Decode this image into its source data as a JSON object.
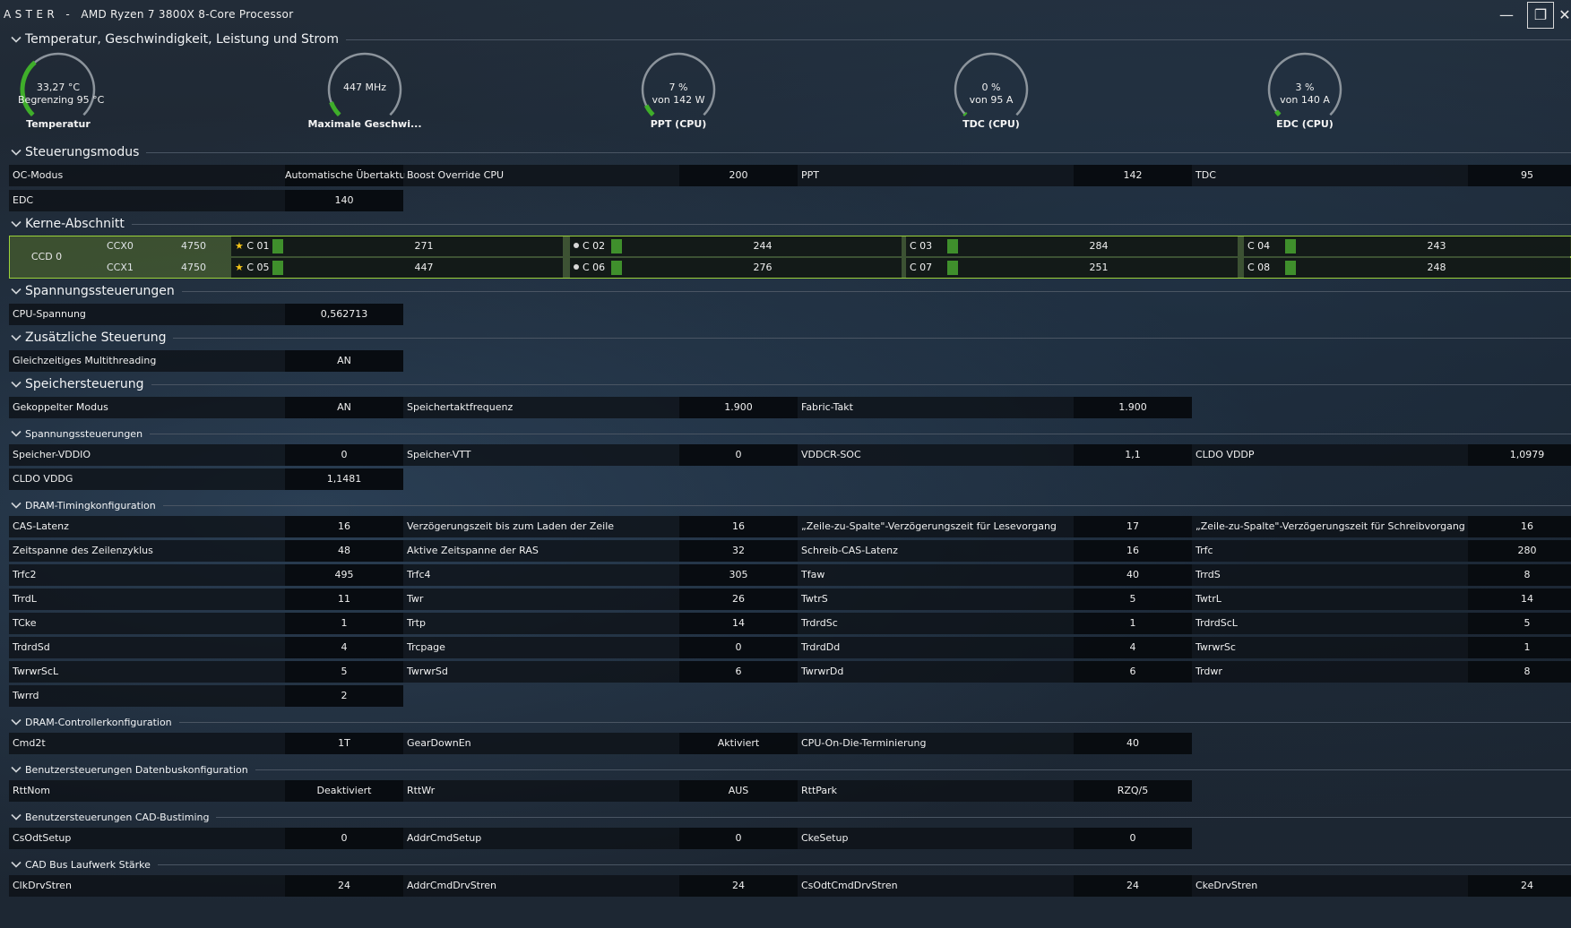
{
  "window": {
    "title": "A S T E R   -   AMD Ryzen 7 3800X 8-Core Processor",
    "min": "—",
    "max": "❐",
    "close": "✕"
  },
  "sections": {
    "temp": "Temperatur, Geschwindigkeit, Leistung und Strom",
    "mode": "Steuerungsmodus",
    "cores": "Kerne-Abschnitt",
    "volt": "Spannungssteuerungen",
    "extra": "Zusätzliche Steuerung",
    "mem": "Speichersteuerung",
    "memvolt": "Spannungssteuerungen",
    "dram": "DRAM-Timingkonfiguration",
    "ctrl": "DRAM-Controllerkonfiguration",
    "bus": "Benutzersteuerungen Datenbuskonfiguration",
    "cad": "Benutzersteuerungen CAD-Bustiming",
    "drv": "CAD Bus Laufwerk Stärke"
  },
  "gauges": [
    {
      "line1": "33,27 °C",
      "line2": "Begrenzing  95 °C",
      "caption": "Temperatur",
      "fill": 0.35
    },
    {
      "line1": "447  MHz",
      "line2": "",
      "caption": "Maximale Geschwi...",
      "fill": 0.09
    },
    {
      "line1": "7 %",
      "line2": "von  142 W",
      "caption": "PPT (CPU)",
      "fill": 0.07
    },
    {
      "line1": "0 %",
      "line2": "von  95 A",
      "caption": "TDC (CPU)",
      "fill": 0.0
    },
    {
      "line1": "3 %",
      "line2": "von  140 A",
      "caption": "EDC (CPU)",
      "fill": 0.03
    }
  ],
  "mode": [
    {
      "k": "OC-Modus",
      "v": "Automatische Übertaktu..."
    },
    {
      "k": "Boost Override CPU",
      "v": "200"
    },
    {
      "k": "PPT",
      "v": "142"
    },
    {
      "k": "TDC",
      "v": "95"
    },
    {
      "k": "EDC",
      "v": "140"
    }
  ],
  "ccd": "CCD 0",
  "ccx": [
    {
      "name": "CCX0",
      "freq": "4750"
    },
    {
      "name": "CCX1",
      "freq": "4750"
    }
  ],
  "cores": [
    {
      "name": "C 01",
      "val": "271"
    },
    {
      "name": "C 02",
      "val": "244"
    },
    {
      "name": "C 03",
      "val": "284"
    },
    {
      "name": "C 04",
      "val": "243"
    },
    {
      "name": "C 05",
      "val": "447"
    },
    {
      "name": "C 06",
      "val": "276"
    },
    {
      "name": "C 07",
      "val": "251"
    },
    {
      "name": "C 08",
      "val": "248"
    }
  ],
  "volt": [
    {
      "k": "CPU-Spannung",
      "v": "0,562713"
    }
  ],
  "extra": [
    {
      "k": "Gleichzeitiges Multithreading",
      "v": "AN"
    }
  ],
  "mem": [
    {
      "k": "Gekoppelter Modus",
      "v": "AN"
    },
    {
      "k": "Speichertaktfrequenz",
      "v": "1.900"
    },
    {
      "k": "Fabric-Takt",
      "v": "1.900"
    }
  ],
  "memvolt": [
    {
      "k": "Speicher-VDDIO",
      "v": "0"
    },
    {
      "k": "Speicher-VTT",
      "v": "0"
    },
    {
      "k": "VDDCR-SOC",
      "v": "1,1"
    },
    {
      "k": "CLDO VDDP",
      "v": "1,0979"
    },
    {
      "k": "CLDO VDDG",
      "v": "1,1481"
    }
  ],
  "dram": [
    {
      "k": "CAS-Latenz",
      "v": "16"
    },
    {
      "k": "Verzögerungszeit bis zum Laden der Zeile",
      "v": "16"
    },
    {
      "k": "„Zeile-zu-Spalte\"-Verzögerungszeit für Lesevorgang",
      "v": "17"
    },
    {
      "k": "„Zeile-zu-Spalte\"-Verzögerungszeit für Schreibvorgang",
      "v": "16"
    },
    {
      "k": "Zeitspanne des Zeilenzyklus",
      "v": "48"
    },
    {
      "k": "Aktive Zeitspanne der RAS",
      "v": "32"
    },
    {
      "k": "Schreib-CAS-Latenz",
      "v": "16"
    },
    {
      "k": "Trfc",
      "v": "280"
    },
    {
      "k": "Trfc2",
      "v": "495"
    },
    {
      "k": "Trfc4",
      "v": "305"
    },
    {
      "k": "Tfaw",
      "v": "40"
    },
    {
      "k": "TrrdS",
      "v": "8"
    },
    {
      "k": "TrrdL",
      "v": "11"
    },
    {
      "k": "Twr",
      "v": "26"
    },
    {
      "k": "TwtrS",
      "v": "5"
    },
    {
      "k": "TwtrL",
      "v": "14"
    },
    {
      "k": "TCke",
      "v": "1"
    },
    {
      "k": "Trtp",
      "v": "14"
    },
    {
      "k": "TrdrdSc",
      "v": "1"
    },
    {
      "k": "TrdrdScL",
      "v": "5"
    },
    {
      "k": "TrdrdSd",
      "v": "4"
    },
    {
      "k": "Trcpage",
      "v": "0"
    },
    {
      "k": "TrdrdDd",
      "v": "4"
    },
    {
      "k": "TwrwrSc",
      "v": "1"
    },
    {
      "k": "TwrwrScL",
      "v": "5"
    },
    {
      "k": "TwrwrSd",
      "v": "6"
    },
    {
      "k": "TwrwrDd",
      "v": "6"
    },
    {
      "k": "Trdwr",
      "v": "8"
    },
    {
      "k": "Twrrd",
      "v": "2"
    }
  ],
  "ctrl": [
    {
      "k": "Cmd2t",
      "v": "1T"
    },
    {
      "k": "GearDownEn",
      "v": "Aktiviert"
    },
    {
      "k": "CPU-On-Die-Terminierung",
      "v": "40"
    }
  ],
  "bus": [
    {
      "k": "RttNom",
      "v": "Deaktiviert"
    },
    {
      "k": "RttWr",
      "v": "AUS"
    },
    {
      "k": "RttPark",
      "v": "RZQ/5"
    }
  ],
  "cad": [
    {
      "k": "CsOdtSetup",
      "v": "0"
    },
    {
      "k": "AddrCmdSetup",
      "v": "0"
    },
    {
      "k": "CkeSetup",
      "v": "0"
    }
  ],
  "drv": [
    {
      "k": "ClkDrvStren",
      "v": "24"
    },
    {
      "k": "AddrCmdDrvStren",
      "v": "24"
    },
    {
      "k": "CsOdtCmdDrvStren",
      "v": "24"
    },
    {
      "k": "CkeDrvStren",
      "v": "24"
    }
  ],
  "colors": {
    "accent": "#3fae2a",
    "gaugeTrack": "#8c949c",
    "coreRowBorder": "#9bd23a"
  }
}
